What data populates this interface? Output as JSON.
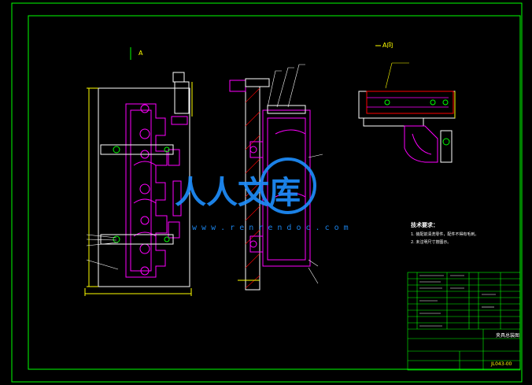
{
  "views": {
    "front_label": "A",
    "section_label": "A向"
  },
  "notes": {
    "title": "技术要求：",
    "line1": "1. 装配前清洗零件，配件不得有毛刺。",
    "line2": "2. 未注明尺寸按图示。"
  },
  "title_block": {
    "drawing_number": "JL043-00",
    "name": "夹具总装图"
  },
  "watermark": {
    "text": "人人文库",
    "url": "w w w . r e n r e n d o c . c o m"
  },
  "colors": {
    "background": "#000000",
    "frame": "#00ff00",
    "part": "#ff00ff",
    "body": "#ffffff",
    "dim": "#ffff00",
    "hatch": "#ff0000",
    "watermark": "#1e90ff"
  }
}
